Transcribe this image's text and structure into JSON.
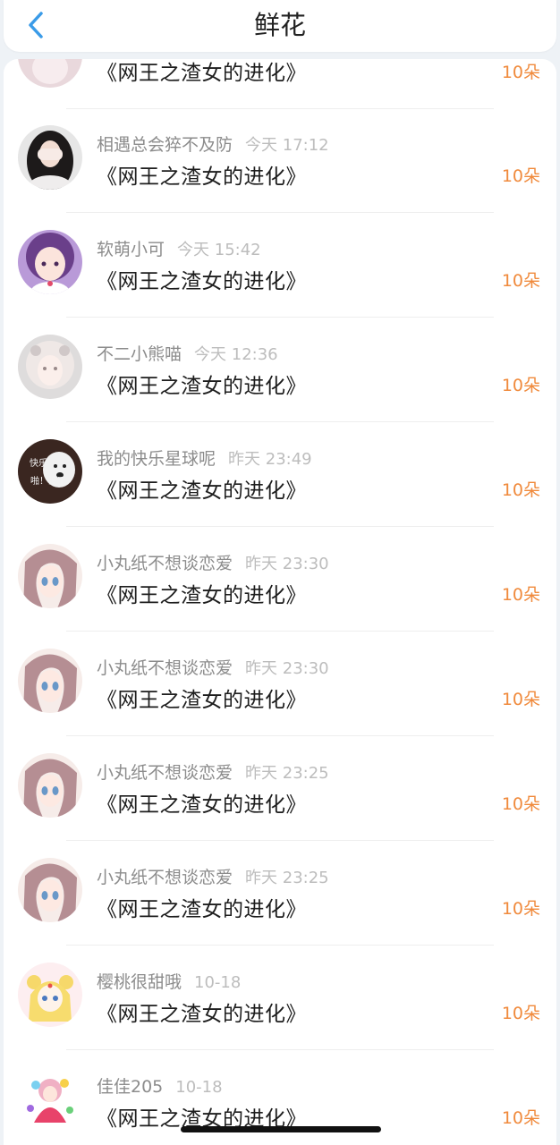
{
  "header": {
    "title": "鲜花",
    "back_icon": "chevron-left-icon",
    "accent_color": "#3a9be8"
  },
  "count_color": "#f08a3c",
  "partial_top": {
    "book": "《网王之渣女的进化》",
    "count": "10朵"
  },
  "items": [
    {
      "name": "相遇总会猝不及防",
      "time": "今天 17:12",
      "book": "《网王之渣女的进化》",
      "count": "10朵",
      "avatar": "dark"
    },
    {
      "name": "软萌小可",
      "time": "今天 15:42",
      "book": "《网王之渣女的进化》",
      "count": "10朵",
      "avatar": "purple"
    },
    {
      "name": "不二小熊喵",
      "time": "今天 12:36",
      "book": "《网王之渣女的进化》",
      "count": "10朵",
      "avatar": "gray"
    },
    {
      "name": "我的快乐星球呢",
      "time": "昨天 23:49",
      "book": "《网王之渣女的进化》",
      "count": "10朵",
      "avatar": "dog",
      "avatar_text": [
        "快乐",
        "啪！没了"
      ]
    },
    {
      "name": "小丸纸不想谈恋爱",
      "time": "昨天 23:30",
      "book": "《网王之渣女的进化》",
      "count": "10朵",
      "avatar": "anime"
    },
    {
      "name": "小丸纸不想谈恋爱",
      "time": "昨天 23:30",
      "book": "《网王之渣女的进化》",
      "count": "10朵",
      "avatar": "anime"
    },
    {
      "name": "小丸纸不想谈恋爱",
      "time": "昨天 23:25",
      "book": "《网王之渣女的进化》",
      "count": "10朵",
      "avatar": "anime"
    },
    {
      "name": "小丸纸不想谈恋爱",
      "time": "昨天 23:25",
      "book": "《网王之渣女的进化》",
      "count": "10朵",
      "avatar": "anime"
    },
    {
      "name": "樱桃很甜哦",
      "time": "10-18",
      "book": "《网王之渣女的进化》",
      "count": "10朵",
      "avatar": "sailor"
    },
    {
      "name": "佳佳205",
      "time": "10-18",
      "book": "《网王之渣女的进化》",
      "count": "10朵",
      "avatar": "colorful"
    }
  ]
}
